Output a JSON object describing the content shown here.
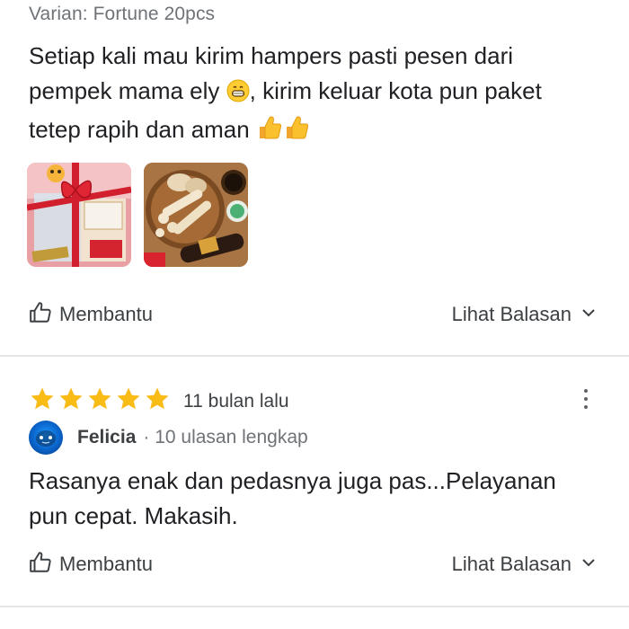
{
  "review1": {
    "variant": "Varian: Fortune 20pcs",
    "text_part1": "Setiap kali mau kirim hampers pasti pesen dari pempek mama ely ",
    "text_part2": ", kirim keluar kota pun paket tetep rapih dan aman ",
    "emojis": [
      "grinning-face-icon",
      "thumbs-up-icon",
      "thumbs-up-icon"
    ],
    "photos": [
      "red-gift-box-hamper-photo",
      "pempek-platter-photo"
    ],
    "helpful_label": "Membantu",
    "replies_label": "Lihat Balasan"
  },
  "review2": {
    "rating": 5,
    "time": "11 bulan lalu",
    "author": "Felicia",
    "meta": "· 10 ulasan lengkap",
    "text": "Rasanya enak dan pedasnya juga pas...Pelayanan pun cepat. Makasih.",
    "helpful_label": "Membantu",
    "replies_label": "Lihat Balasan"
  },
  "colors": {
    "star": "#f9bb16",
    "text": "#202124",
    "secondary": "#6f7378",
    "divider": "#e4e5e7"
  }
}
